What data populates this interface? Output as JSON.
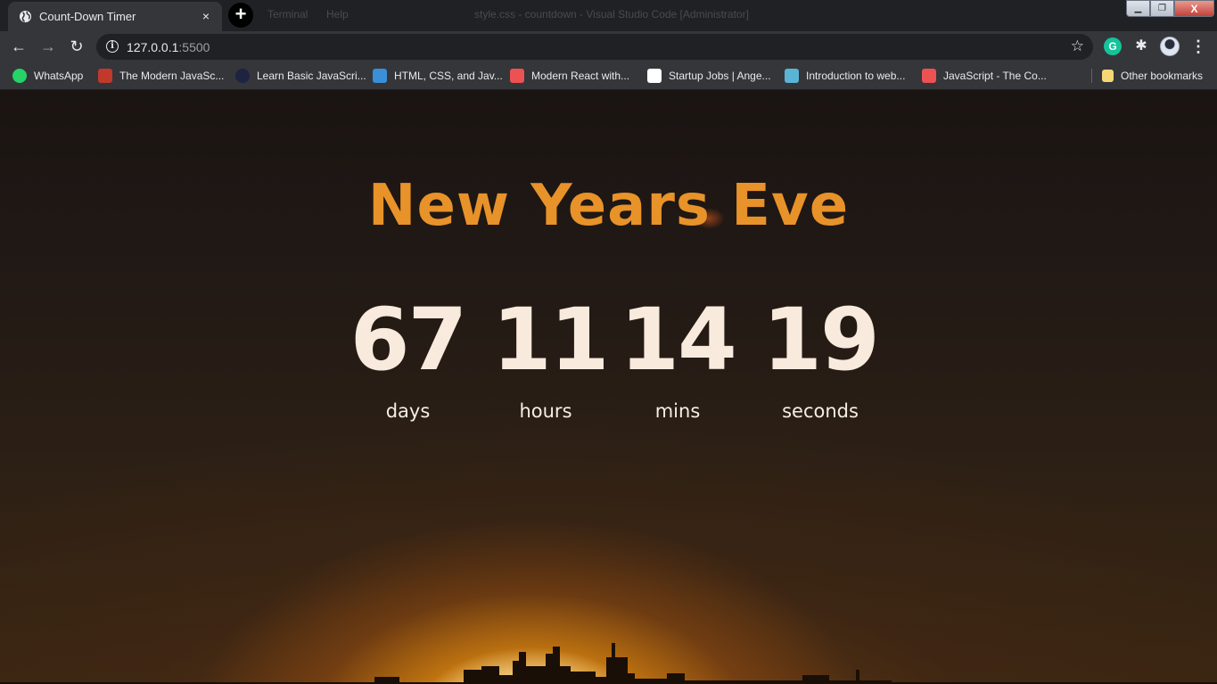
{
  "tab": {
    "title": "Count-Down Timer",
    "close": "×"
  },
  "new_tab": "+",
  "ghost_menu": [
    "Terminal",
    "Help"
  ],
  "ghost_title": "style.css - countdown - Visual Studio Code [Administrator]",
  "window_controls": {
    "minimize": "▁",
    "maximize": "❐",
    "close": "X"
  },
  "toolbar": {
    "back": "←",
    "forward": "→",
    "reload": "↻",
    "url_host": "127.0.0.1",
    "url_port": ":5500",
    "star": "☆",
    "grammarly": "G",
    "extensions": "✱",
    "menu": "⋮"
  },
  "bookmarks": [
    {
      "label": "WhatsApp",
      "color": "#25d366"
    },
    {
      "label": "The Modern JavaSc...",
      "color": "#c0392b"
    },
    {
      "label": "Learn Basic JavaScri...",
      "color": "#1d2340"
    },
    {
      "label": "HTML, CSS, and Jav...",
      "color": "#3a8fd8"
    },
    {
      "label": "Modern React with...",
      "color": "#ec5252"
    },
    {
      "label": "Startup Jobs | Ange...",
      "color": "#ffffff"
    },
    {
      "label": "Introduction to web...",
      "color": "#5ab4d6"
    },
    {
      "label": "JavaScript - The Co...",
      "color": "#ec5252"
    }
  ],
  "other_bookmarks": "Other bookmarks",
  "page": {
    "title": "New Years Eve",
    "countdown": [
      {
        "value": "67",
        "label": "days"
      },
      {
        "value": "11",
        "label": "hours"
      },
      {
        "value": "14",
        "label": "mins"
      },
      {
        "value": "19",
        "label": "seconds"
      }
    ]
  }
}
